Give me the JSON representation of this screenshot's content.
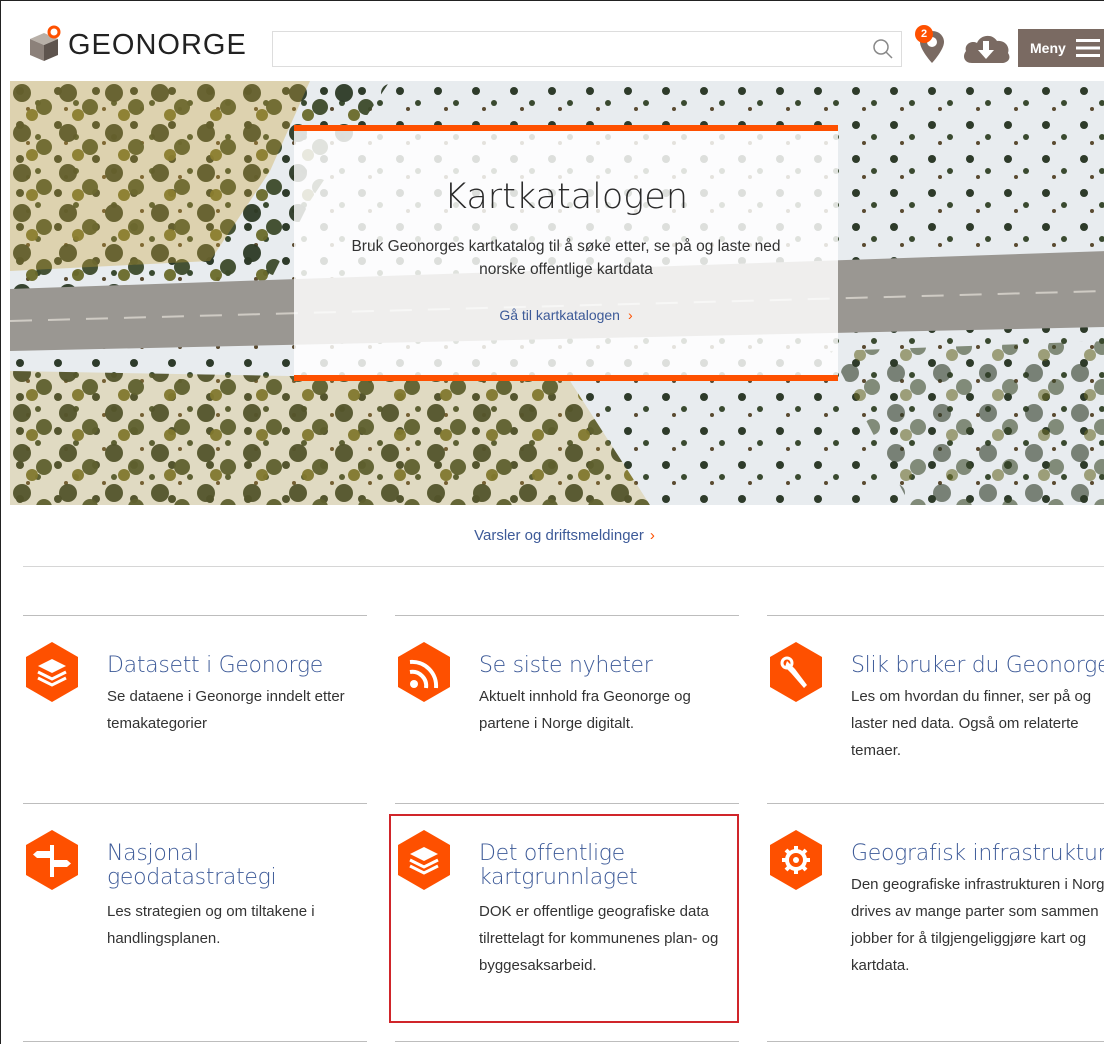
{
  "header": {
    "logo_text": "GEONORGE",
    "search_placeholder": "",
    "badge_count": "2",
    "menu_label": "Meny"
  },
  "hero": {
    "title": "Kartkatalogen",
    "subtitle": "Bruk Geonorges kartkatalog til å søke etter, se på og laste ned norske offentlige kartdata",
    "link": "Gå til kartkatalogen",
    "chevron": "›"
  },
  "alerts": {
    "link": "Varsler og driftsmeldinger",
    "chevron": "›"
  },
  "tiles": [
    {
      "icon": "layers-icon",
      "title": "Datasett i Geonorge",
      "desc": "Se dataene i Geonorge inndelt etter temakategorier"
    },
    {
      "icon": "rss-icon",
      "title": "Se siste nyheter",
      "desc": "Aktuelt innhold fra Geonorge og partene i Norge digitalt."
    },
    {
      "icon": "wrench-icon",
      "title": "Slik bruker du Geonorge",
      "desc": "Les om hvordan du finner, ser på og laster ned data. Også om relaterte temaer."
    },
    {
      "icon": "signpost-icon",
      "title": "Nasjonal geodatastrategi",
      "desc": "Les strategien og om tiltakene i handlingsplanen."
    },
    {
      "icon": "layers-icon",
      "title": "Det offentlige kartgrunnlaget",
      "desc": "DOK er offentlige geografiske data tilrettelagt for kommunenes plan- og byggesaksarbeid."
    },
    {
      "icon": "gear-icon",
      "title": "Geografisk infrastruktur",
      "desc": "Den geografiske infrastrukturen i Norge drives av mange parter som sammen jobber for å tilgjengeliggjøre kart og kartdata."
    }
  ],
  "colors": {
    "accent": "#fe5000",
    "link": "#3d5a98",
    "menu_bg": "#7a6a62",
    "highlight": "#d0252a"
  }
}
